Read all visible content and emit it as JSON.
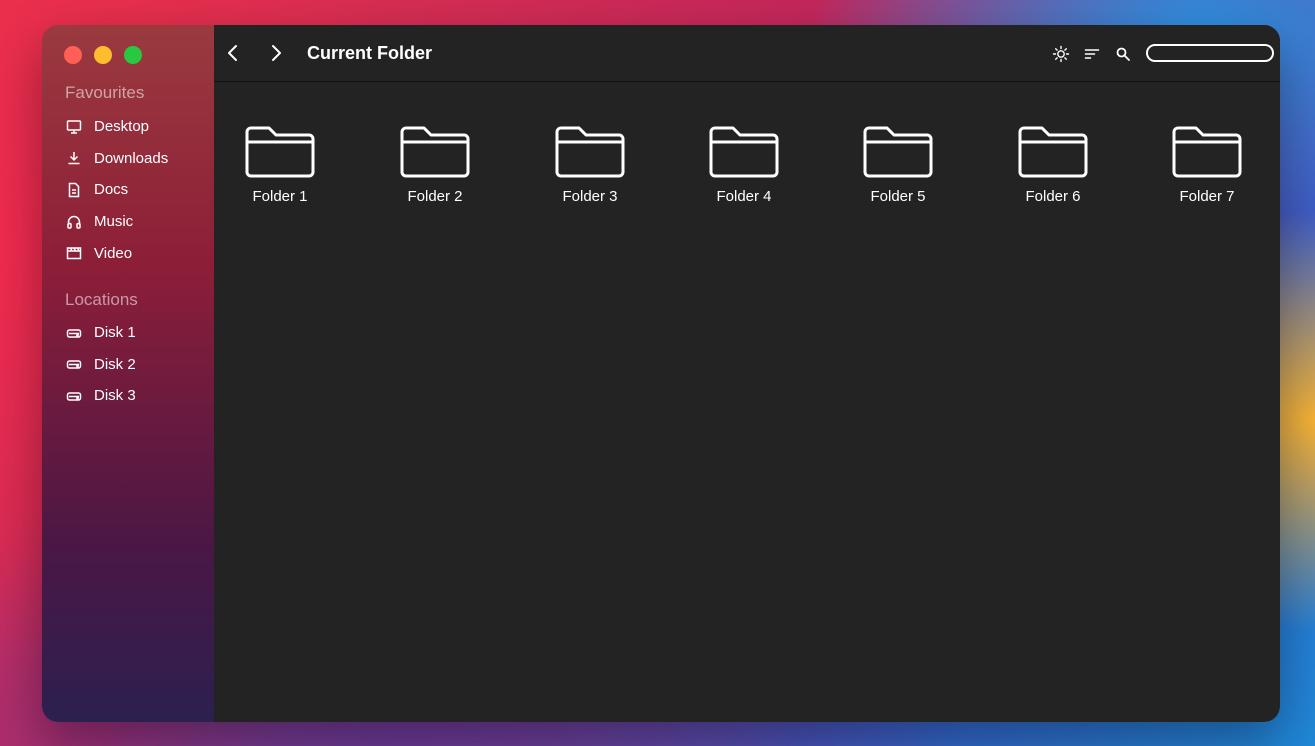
{
  "window": {
    "title": "Current Folder"
  },
  "sidebar": {
    "favourites_title": "Favourites",
    "favourites": [
      {
        "label": "Desktop",
        "icon": "monitor-icon"
      },
      {
        "label": "Downloads",
        "icon": "download-icon"
      },
      {
        "label": "Docs",
        "icon": "document-icon"
      },
      {
        "label": "Music",
        "icon": "headphones-icon"
      },
      {
        "label": "Video",
        "icon": "clapperboard-icon"
      }
    ],
    "locations_title": "Locations",
    "locations": [
      {
        "label": "Disk 1",
        "icon": "disk-icon"
      },
      {
        "label": "Disk 2",
        "icon": "disk-icon"
      },
      {
        "label": "Disk 3",
        "icon": "disk-icon"
      }
    ]
  },
  "toolbar": {
    "back_icon": "chevron-left-icon",
    "forward_icon": "chevron-right-icon",
    "brightness_icon": "sun-icon",
    "sort_icon": "sort-icon",
    "search_icon": "search-icon",
    "search_value": ""
  },
  "folders": [
    {
      "label": "Folder 1",
      "icon": "folder-icon"
    },
    {
      "label": "Folder 2",
      "icon": "folder-icon"
    },
    {
      "label": "Folder 3",
      "icon": "folder-icon"
    },
    {
      "label": "Folder 4",
      "icon": "folder-icon"
    },
    {
      "label": "Folder 5",
      "icon": "folder-icon"
    },
    {
      "label": "Folder 6",
      "icon": "folder-icon"
    },
    {
      "label": "Folder 7",
      "icon": "folder-icon"
    }
  ],
  "colors": {
    "close": "#fe5f57",
    "minimize": "#febc2e",
    "zoom": "#28c840",
    "content_bg": "#232323"
  }
}
